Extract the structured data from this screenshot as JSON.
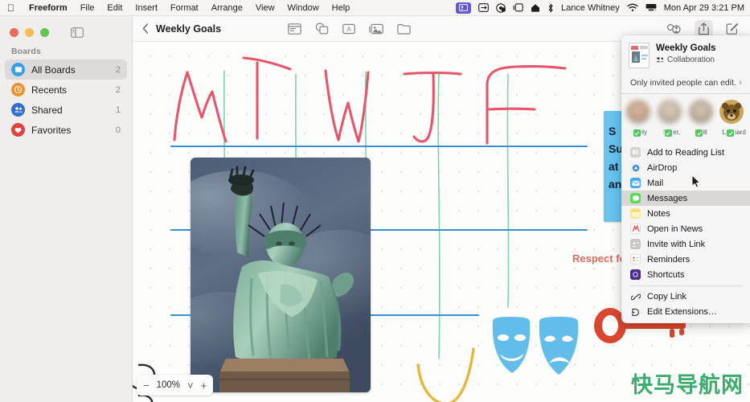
{
  "menubar": {
    "apple_icon": "apple-logo-icon",
    "items": [
      "Freeform",
      "File",
      "Edit",
      "Insert",
      "Format",
      "Arrange",
      "View",
      "Window",
      "Help"
    ],
    "status_icons": [
      "control-center-user-icon",
      "screen-mirroring-icon",
      "focus-icon",
      "stage-manager-icon",
      "wifi-home-icon",
      "bluetooth-icon"
    ],
    "user": "Lance Whitney",
    "right_icons": [
      "wifi-icon",
      "control-center-icon"
    ],
    "clock": "Mon Apr 29  3:21 PM"
  },
  "window": {
    "traffic_lights": [
      "close-button",
      "minimize-button",
      "maximize-button"
    ],
    "sidebar_toggle_icon": "sidebar-toggle-icon"
  },
  "sidebar": {
    "section_label": "Boards",
    "items": [
      {
        "label": "All Boards",
        "count": "2",
        "icon": "board-icon",
        "color": "#3c9ee5",
        "selected": true
      },
      {
        "label": "Recents",
        "count": "2",
        "icon": "clock-icon",
        "color": "#f0912d",
        "selected": false
      },
      {
        "label": "Shared",
        "count": "1",
        "icon": "people-icon",
        "color": "#2f6fd0",
        "selected": false
      },
      {
        "label": "Favorites",
        "count": "0",
        "icon": "heart-icon",
        "color": "#e0453c",
        "selected": false
      }
    ]
  },
  "toolbar": {
    "back_icon": "chevron-left-icon",
    "title": "Weekly Goals",
    "tools": [
      "sticky-note-icon",
      "shapes-icon",
      "text-box-icon",
      "media-icon",
      "insert-file-icon"
    ],
    "right_tools": [
      "collaborate-icon",
      "share-icon",
      "compose-icon"
    ]
  },
  "canvas": {
    "handwriting": [
      "M",
      "T",
      "W",
      "T",
      "F"
    ],
    "sticky_note": {
      "color": "#68c3f0",
      "lines": [
        "S",
        "Sur",
        "at t",
        "an"
      ]
    },
    "respect_text": "Respect fo",
    "photo_alt": "statue-of-liberty-photo",
    "stickers": [
      "theater-masks-sticker",
      "key-sticker"
    ],
    "zoom": {
      "minus": "−",
      "level": "100%",
      "chevron": "˅",
      "plus": "+"
    },
    "watermark": "快马导航网"
  },
  "share_popover": {
    "board_title": "Weekly Goals",
    "board_subtitle": "Collaboration",
    "collab_icon": "collaboration-icon",
    "permission": "Only invited people can edit.",
    "permission_chevron": "›",
    "participants": [
      {
        "name": "Cely"
      },
      {
        "name": "Peter,"
      },
      {
        "name": "Bill"
      },
      {
        "name": "Leonard"
      }
    ],
    "menu_items": [
      {
        "label": "Add to Reading List",
        "icon": "reading-list-icon",
        "color": "#d6d3cf",
        "active": false
      },
      {
        "label": "AirDrop",
        "icon": "airdrop-icon",
        "color": "#f2f2f5",
        "active": false
      },
      {
        "label": "Mail",
        "icon": "mail-icon",
        "color": "#3fa9f5",
        "active": false
      },
      {
        "label": "Messages",
        "icon": "messages-icon",
        "color": "#5fd75f",
        "active": true
      },
      {
        "label": "Notes",
        "icon": "notes-icon",
        "color": "#fbe189",
        "active": false
      },
      {
        "label": "Open in News",
        "icon": "news-icon",
        "color": "#ffffff",
        "active": false
      },
      {
        "label": "Invite with Link",
        "icon": "invite-link-icon",
        "color": "#c9c7c4",
        "active": false
      },
      {
        "label": "Reminders",
        "icon": "reminders-icon",
        "color": "#ffffff",
        "active": false
      },
      {
        "label": "Shortcuts",
        "icon": "shortcuts-icon",
        "color": "#4b2d8e",
        "active": false
      }
    ],
    "footer_items": [
      {
        "label": "Copy Link",
        "icon": "link-icon"
      },
      {
        "label": "Edit Extensions…",
        "icon": "extensions-icon"
      }
    ]
  }
}
